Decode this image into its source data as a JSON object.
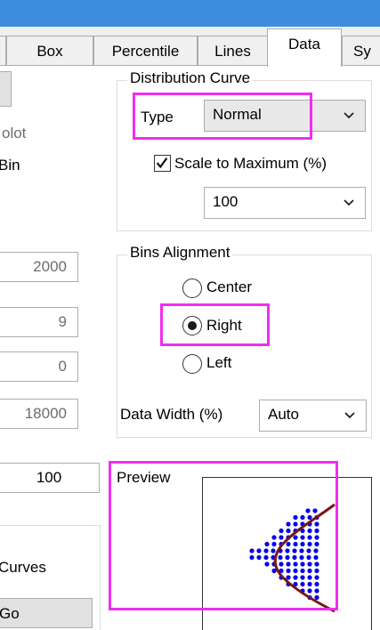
{
  "tabs": [
    {
      "label": "Box",
      "active": false
    },
    {
      "label": "Percentile",
      "active": false
    },
    {
      "label": "Lines",
      "active": false
    },
    {
      "label": "Data",
      "active": true
    },
    {
      "label": "Sy",
      "active": false
    }
  ],
  "left": {
    "plot_label": "olot",
    "bin_label": "Bin",
    "fields": [
      "2000",
      "9",
      "0",
      "18000"
    ],
    "value_field": "100",
    "curves_label": "Curves",
    "go_button": "Go"
  },
  "distribution_curve": {
    "title": "Distribution Curve",
    "type_label": "Type",
    "type_value": "Normal",
    "scale_checkbox_label": "Scale to Maximum (%)",
    "scale_checked": true,
    "scale_value": "100"
  },
  "bins_alignment": {
    "title": "Bins Alignment",
    "options": [
      {
        "label": "Center",
        "checked": false
      },
      {
        "label": "Right",
        "checked": true
      },
      {
        "label": "Left",
        "checked": false
      }
    ],
    "data_width_label": "Data Width (%)",
    "data_width_value": "Auto"
  },
  "preview": {
    "label": "Preview"
  },
  "colors": {
    "highlight": "#ee2fee",
    "dots": "#0000ee",
    "curve": "#7a1515",
    "title_bar": "#3d8ee0"
  }
}
